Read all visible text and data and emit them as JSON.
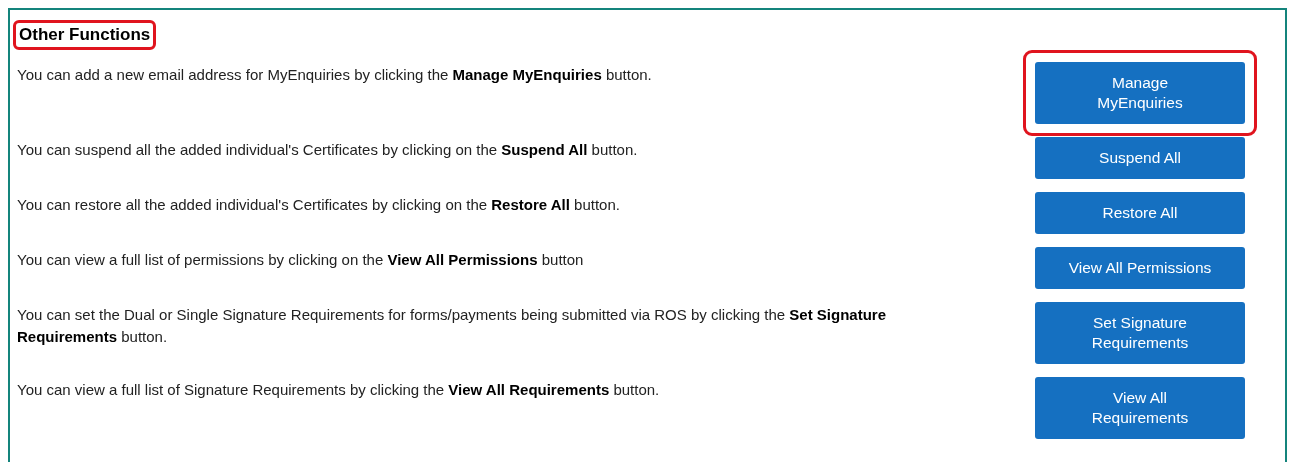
{
  "section": {
    "title": "Other Functions",
    "title_highlighted": true
  },
  "functions": [
    {
      "description": "You can add a new email address for MyEnquiries by clicking the **Manage MyEnquiries** button.",
      "button": "Manage\nMyEnquiries",
      "highlighted": true
    },
    {
      "description": "You can suspend all the added individual's Certificates by clicking on the **Suspend All** button.",
      "button": "Suspend All",
      "highlighted": false
    },
    {
      "description": "You can restore all the added individual's Certificates by clicking on the **Restore All** button.",
      "button": "Restore All",
      "highlighted": false
    },
    {
      "description": "You can view a full list of permissions by clicking on the **View All Permissions** button",
      "button": "View All Permissions",
      "highlighted": false
    },
    {
      "description": "You can set the Dual or Single Signature Requirements for forms/payments being submitted via ROS by clicking the **Set Signature Requirements** button.",
      "button": "Set Signature\nRequirements",
      "highlighted": false
    },
    {
      "description": "You can view a full list of Signature Requirements by clicking the **View All Requirements** button.",
      "button": "View All\nRequirements",
      "highlighted": false
    }
  ]
}
